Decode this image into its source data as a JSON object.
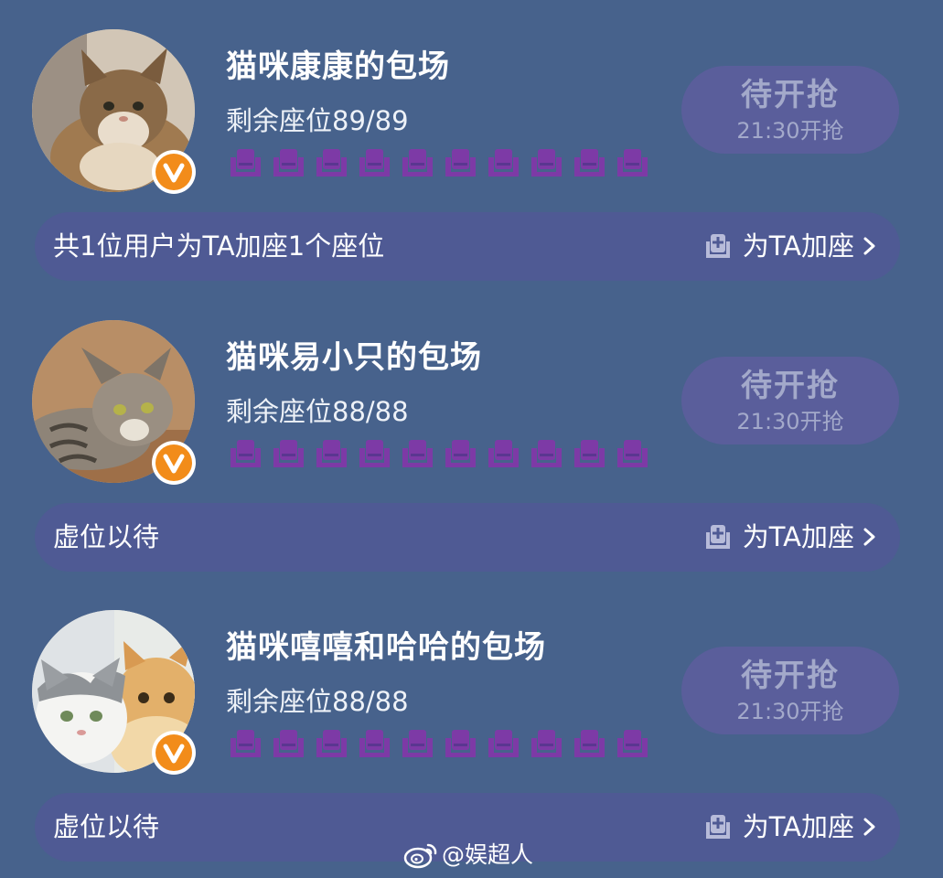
{
  "colors": {
    "background": "#47628c",
    "seat_purple": "#7d3aa6",
    "grab_button_bg": "#5a5e9b",
    "bar_bg": "#4f5a94",
    "badge_orange": "#f28c1a"
  },
  "cards": [
    {
      "title": "猫咪康康的包场",
      "seats_remaining": "剩余座位89/89",
      "grab_button": {
        "label": "待开抢",
        "time": "21:30开抢"
      },
      "footer_text": "共1位用户为TA加座1个座位",
      "add_seat_label": "为TA加座",
      "avatar": "fluffy-cat-avatar",
      "badge_icon": "v-badge-icon"
    },
    {
      "title": "猫咪易小只的包场",
      "seats_remaining": "剩余座位88/88",
      "grab_button": {
        "label": "待开抢",
        "time": "21:30开抢"
      },
      "footer_text": "虚位以待",
      "add_seat_label": "为TA加座",
      "avatar": "tabby-cat-avatar",
      "badge_icon": "v-badge-icon"
    },
    {
      "title": "猫咪嘻嘻和哈哈的包场",
      "seats_remaining": "剩余座位88/88",
      "grab_button": {
        "label": "待开抢",
        "time": "21:30开抢"
      },
      "footer_text": "虚位以待",
      "add_seat_label": "为TA加座",
      "avatar": "two-cats-avatar",
      "badge_icon": "v-badge-icon"
    }
  ],
  "watermark": {
    "icon": "weibo-icon",
    "text": "@娱超人"
  }
}
